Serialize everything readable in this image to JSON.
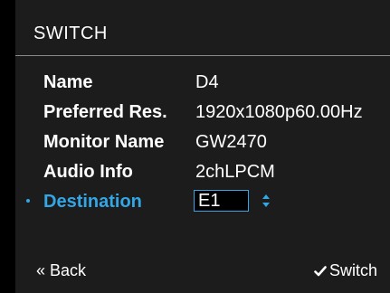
{
  "header": {
    "title": "SWITCH"
  },
  "properties": [
    {
      "label": "Name",
      "value": "D4"
    },
    {
      "label": "Preferred Res.",
      "value": "1920x1080p60.00Hz"
    },
    {
      "label": "Monitor Name",
      "value": "GW2470"
    },
    {
      "label": "Audio Info",
      "value": "2chLPCM"
    }
  ],
  "destination": {
    "label": "Destination",
    "value": "E1"
  },
  "footer": {
    "back_label": "« Back",
    "switch_label": "Switch"
  },
  "colors": {
    "accent": "#33a6e6",
    "panel_background": "#1c1c1c",
    "text": "#ffffff"
  },
  "icons": {
    "selection": "bullet-dot-icon",
    "spinner": "up-down-spinner-icon",
    "confirm": "checkmark-icon"
  }
}
